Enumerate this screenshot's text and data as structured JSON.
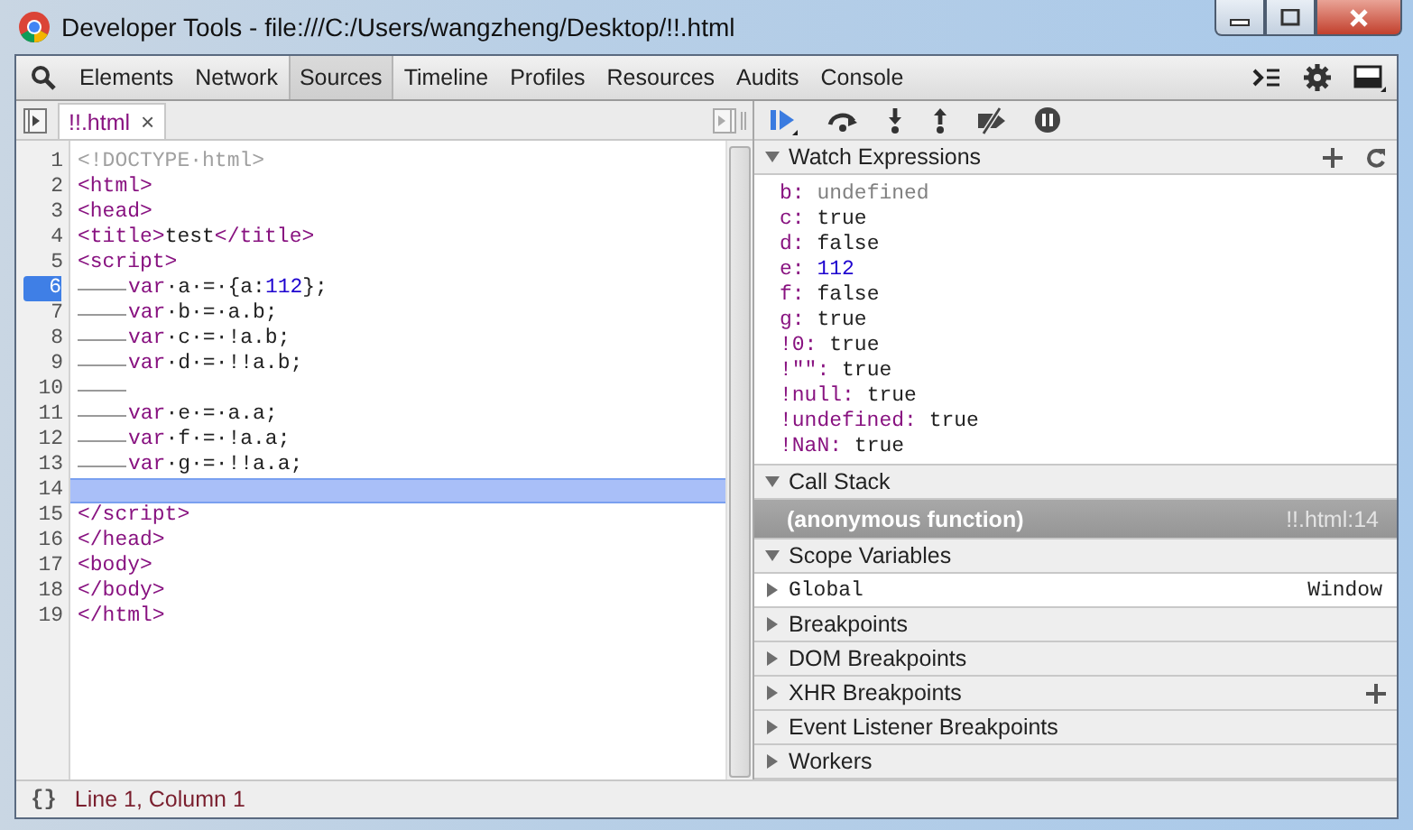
{
  "window": {
    "title": "Developer Tools - file:///C:/Users/wangzheng/Desktop/!!.html"
  },
  "panel_tabs": [
    {
      "label": "Elements",
      "selected": false
    },
    {
      "label": "Network",
      "selected": false
    },
    {
      "label": "Sources",
      "selected": true
    },
    {
      "label": "Timeline",
      "selected": false
    },
    {
      "label": "Profiles",
      "selected": false
    },
    {
      "label": "Resources",
      "selected": false
    },
    {
      "label": "Audits",
      "selected": false
    },
    {
      "label": "Console",
      "selected": false
    }
  ],
  "source_tabs": [
    {
      "label": "!!.html",
      "close": "×",
      "selected": true
    }
  ],
  "code_lines": [
    {
      "number": "1",
      "indented": false,
      "breakpoint": false,
      "current": false,
      "segments": [
        {
          "kind": "comment",
          "text": "<!DOCTYPE·html>"
        }
      ]
    },
    {
      "number": "2",
      "indented": false,
      "breakpoint": false,
      "current": false,
      "segments": [
        {
          "kind": "tag",
          "text": "<html>"
        }
      ]
    },
    {
      "number": "3",
      "indented": false,
      "breakpoint": false,
      "current": false,
      "segments": [
        {
          "kind": "tag",
          "text": "<head>"
        }
      ]
    },
    {
      "number": "4",
      "indented": false,
      "breakpoint": false,
      "current": false,
      "segments": [
        {
          "kind": "tag",
          "text": "<title>"
        },
        {
          "kind": "text",
          "text": "test"
        },
        {
          "kind": "tag",
          "text": "</title>"
        }
      ]
    },
    {
      "number": "5",
      "indented": false,
      "breakpoint": false,
      "current": false,
      "segments": [
        {
          "kind": "tag",
          "text": "<script>"
        }
      ]
    },
    {
      "number": "6",
      "indented": true,
      "breakpoint": true,
      "current": false,
      "segments": [
        {
          "kind": "keyword",
          "text": "var"
        },
        {
          "kind": "text",
          "text": "·a·=·{a:"
        },
        {
          "kind": "number",
          "text": "112"
        },
        {
          "kind": "text",
          "text": "};"
        }
      ]
    },
    {
      "number": "7",
      "indented": true,
      "breakpoint": false,
      "current": false,
      "segments": [
        {
          "kind": "keyword",
          "text": "var"
        },
        {
          "kind": "text",
          "text": "·b·=·a.b;"
        }
      ]
    },
    {
      "number": "8",
      "indented": true,
      "breakpoint": false,
      "current": false,
      "segments": [
        {
          "kind": "keyword",
          "text": "var"
        },
        {
          "kind": "text",
          "text": "·c·=·!a.b;"
        }
      ]
    },
    {
      "number": "9",
      "indented": true,
      "breakpoint": false,
      "current": false,
      "segments": [
        {
          "kind": "keyword",
          "text": "var"
        },
        {
          "kind": "text",
          "text": "·d·=·!!a.b;"
        }
      ]
    },
    {
      "number": "10",
      "indented": true,
      "breakpoint": false,
      "current": false
    },
    {
      "number": "11",
      "indented": true,
      "breakpoint": false,
      "current": false,
      "segments": [
        {
          "kind": "keyword",
          "text": "var"
        },
        {
          "kind": "text",
          "text": "·e·=·a.a;"
        }
      ]
    },
    {
      "number": "12",
      "indented": true,
      "breakpoint": false,
      "current": false,
      "segments": [
        {
          "kind": "keyword",
          "text": "var"
        },
        {
          "kind": "text",
          "text": "·f·=·!a.a;"
        }
      ]
    },
    {
      "number": "13",
      "indented": true,
      "breakpoint": false,
      "current": false,
      "segments": [
        {
          "kind": "keyword",
          "text": "var"
        },
        {
          "kind": "text",
          "text": "·g·=·!!a.a;"
        }
      ]
    },
    {
      "number": "14",
      "indented": false,
      "breakpoint": false,
      "current": true
    },
    {
      "number": "15",
      "indented": false,
      "breakpoint": false,
      "current": false,
      "segments": [
        {
          "kind": "tag",
          "text": "</script>"
        }
      ]
    },
    {
      "number": "16",
      "indented": false,
      "breakpoint": false,
      "current": false,
      "segments": [
        {
          "kind": "tag",
          "text": "</head>"
        }
      ]
    },
    {
      "number": "17",
      "indented": false,
      "breakpoint": false,
      "current": false,
      "segments": [
        {
          "kind": "tag",
          "text": "<body>"
        }
      ]
    },
    {
      "number": "18",
      "indented": false,
      "breakpoint": false,
      "current": false,
      "segments": [
        {
          "kind": "tag",
          "text": "</body>"
        }
      ]
    },
    {
      "number": "19",
      "indented": false,
      "breakpoint": false,
      "current": false,
      "segments": [
        {
          "kind": "tag",
          "text": "</html>"
        }
      ]
    }
  ],
  "watch": {
    "title": "Watch Expressions",
    "expanded": true,
    "items": [
      {
        "name": "b:",
        "value": "undefined",
        "kind": "undefined"
      },
      {
        "name": "c:",
        "value": "true",
        "kind": "boolean"
      },
      {
        "name": "d:",
        "value": "false",
        "kind": "boolean"
      },
      {
        "name": "e:",
        "value": "112",
        "kind": "number"
      },
      {
        "name": "f:",
        "value": "false",
        "kind": "boolean"
      },
      {
        "name": "g:",
        "value": "true",
        "kind": "boolean"
      },
      {
        "name": "!0:",
        "value": "true",
        "kind": "boolean"
      },
      {
        "name": "!\"\":",
        "value": "true",
        "kind": "boolean"
      },
      {
        "name": "!null:",
        "value": "true",
        "kind": "boolean"
      },
      {
        "name": "!undefined:",
        "value": "true",
        "kind": "boolean"
      },
      {
        "name": "!NaN:",
        "value": "true",
        "kind": "boolean"
      }
    ]
  },
  "call_stack": {
    "title": "Call Stack",
    "expanded": true,
    "frames": [
      {
        "function": "(anonymous function)",
        "location": "!!.html:14",
        "selected": true
      }
    ]
  },
  "scope": {
    "title": "Scope Variables",
    "expanded": true,
    "items": [
      {
        "name": "Global",
        "value": "Window",
        "expanded": false
      }
    ]
  },
  "sections": [
    {
      "title": "Breakpoints",
      "expanded": false,
      "add": false
    },
    {
      "title": "DOM Breakpoints",
      "expanded": false,
      "add": false
    },
    {
      "title": "XHR Breakpoints",
      "expanded": false,
      "add": true
    },
    {
      "title": "Event Listener Breakpoints",
      "expanded": false,
      "add": false
    },
    {
      "title": "Workers",
      "expanded": false,
      "add": false
    }
  ],
  "status_bar": {
    "icon": "{}",
    "position": "Line 1, Column 1"
  }
}
